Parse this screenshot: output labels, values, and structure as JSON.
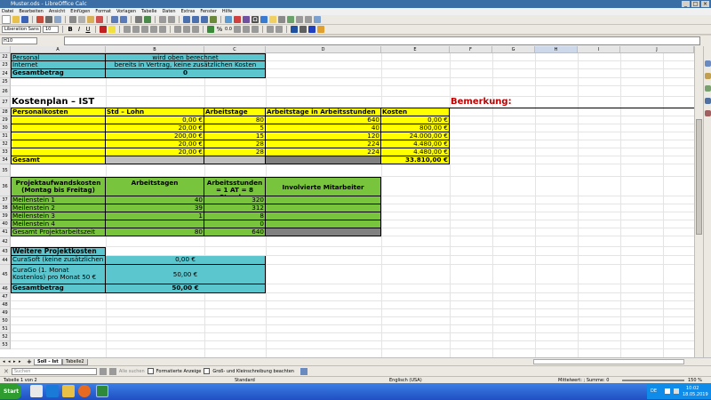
{
  "window": {
    "title": "Muster.ods - LibreOffice Calc"
  },
  "menu": [
    "Datei",
    "Bearbeiten",
    "Ansicht",
    "Einfügen",
    "Format",
    "Vorlagen",
    "Tabelle",
    "Daten",
    "Extras",
    "Fenster",
    "Hilfe"
  ],
  "formatbar": {
    "font": "Liberation Sans",
    "size": "10"
  },
  "formula": {
    "namebox": "H10",
    "content": ""
  },
  "columns": [
    "A",
    "B",
    "C",
    "D",
    "E",
    "F",
    "G",
    "H",
    "I",
    "J"
  ],
  "selected_column": "H",
  "rows": [
    "22",
    "23",
    "24",
    "25",
    "26",
    "27",
    "28",
    "29",
    "30",
    "31",
    "32",
    "33",
    "34",
    "35",
    "36",
    "37",
    "38",
    "39",
    "40",
    "41",
    "42",
    "43",
    "44",
    "45",
    "46",
    "47",
    "48",
    "49",
    "50",
    "51",
    "52",
    "53"
  ],
  "top_block": {
    "r22": {
      "a": "Personal",
      "b": "wird oben berechnet"
    },
    "r23": {
      "a": "Internet",
      "b": "bereits in Vertrag, keine zusätzlichen Kosten"
    },
    "r24": {
      "a": "Gesamtbetrag",
      "b": "0"
    }
  },
  "kostenplan": {
    "title": "Kostenplan – IST",
    "bemerkung": "Bemerkung:",
    "headers": [
      "Personalkosten",
      "Std – Lohn",
      "Arbeitstage",
      "Arbeitstage in Arbeitsstunden",
      "Kosten"
    ],
    "rows": [
      [
        "",
        "0,00 €",
        "80",
        "640",
        "0,00 €"
      ],
      [
        "",
        "20,00 €",
        "5",
        "40",
        "800,00 €"
      ],
      [
        "",
        "200,00 €",
        "15",
        "120",
        "24.000,00 €"
      ],
      [
        "",
        "20,00 €",
        "28",
        "224",
        "4.480,00 €"
      ],
      [
        "",
        "20,00 €",
        "28",
        "224",
        "4.480,00 €"
      ]
    ],
    "total_label": "Gesamt",
    "total_value": "33.810,00 €"
  },
  "projekt": {
    "h1": "Projektaufwandskosten (Montag bis Freitag)",
    "h2": "Arbeitstagen",
    "h3": "Arbeitsstunden = 1 AT = 8 Stunden",
    "h4": "Involvierte Mitarbeiter",
    "rows": [
      [
        "Meilenstein 1",
        "40",
        "320"
      ],
      [
        "Meilenstein 2",
        "39",
        "312"
      ],
      [
        "Meilenstein 3",
        "1",
        "8"
      ],
      [
        "Meilenstein 4",
        "",
        "0"
      ]
    ],
    "total": [
      "Gesamt Projektarbeitszeit",
      "80",
      "640"
    ]
  },
  "weitere": {
    "title": "Weitere Projektkosten",
    "r1a": "CuraSoft (keine zusätzlichen Kosten)",
    "r1b": "0,00 €",
    "r2a": "CuraGo (1. Monat Kostenlos) pro Monat 50 €",
    "r2b": "50,00 €",
    "r3a": "Gesamtbetrag",
    "r3b": "50,00 €"
  },
  "tabs": [
    "Soll – Ist",
    "Tabelle2"
  ],
  "find": {
    "placeholder": "Suchen",
    "all_label": "Alle suchen",
    "opt1": "Formatierte Anzeige",
    "opt2": "Groß- und Kleinschreibung beachten"
  },
  "status": {
    "sheet": "Tabelle 1 von 2",
    "style": "Standard",
    "lang": "Englisch (USA)",
    "calc": "Mittelwert: ; Summe: 0",
    "zoom": "150 %"
  },
  "taskbar": {
    "start": "Start",
    "lang": "DE",
    "time": "10:02",
    "date": "18.05.2019"
  }
}
